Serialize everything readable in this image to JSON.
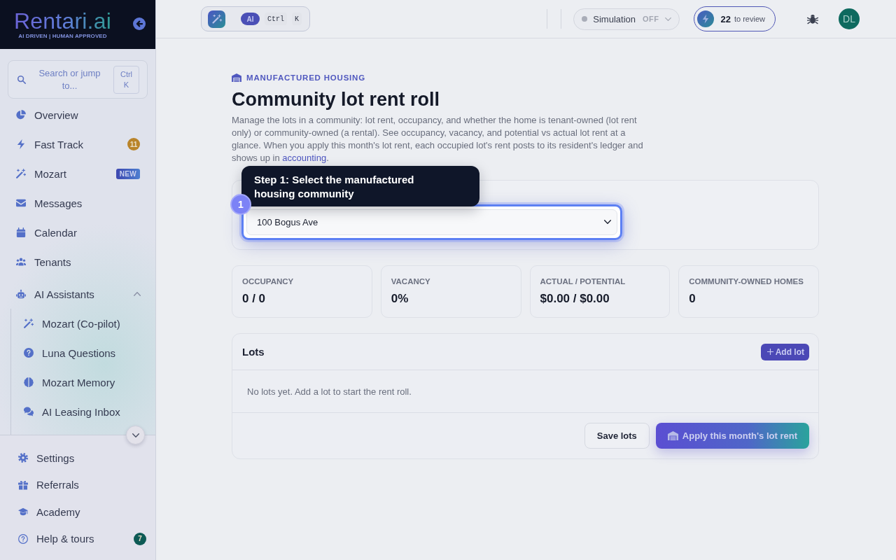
{
  "sidebar": {
    "logo": {
      "wordmark": "Rentari.ai",
      "tagline": "AI DRIVEN | HUMAN APPROVED"
    },
    "search": {
      "placeholder": "Search or jump to...",
      "shortcut": "Ctrl K"
    },
    "nav": [
      {
        "label": "Overview"
      },
      {
        "label": "Fast Track",
        "badge": {
          "kind": "count",
          "text": "11",
          "color": "#b9842a"
        }
      },
      {
        "label": "Mozart",
        "badge": {
          "kind": "new",
          "text": "NEW"
        }
      },
      {
        "label": "Messages"
      },
      {
        "label": "Calendar"
      },
      {
        "label": "Tenants"
      },
      {
        "label": "AI Assistants",
        "expanded": true,
        "children": [
          {
            "label": "Mozart (Co-pilot)"
          },
          {
            "label": "Luna Questions"
          },
          {
            "label": "Mozart Memory"
          },
          {
            "label": "AI Leasing Inbox"
          }
        ]
      }
    ],
    "footer_nav": [
      {
        "label": "Settings"
      },
      {
        "label": "Referrals"
      },
      {
        "label": "Academy"
      },
      {
        "label": "Help & tours",
        "badge": {
          "kind": "count",
          "text": "7",
          "color": "#0d5a55"
        }
      }
    ]
  },
  "topbar": {
    "command": {
      "ai_label": "AI",
      "keys": [
        "Ctrl",
        "K"
      ]
    },
    "simulation": {
      "label": "Simulation",
      "state": "OFF",
      "on": false
    },
    "review": {
      "count": "22",
      "label": "to review"
    },
    "avatar": {
      "initials": "DL"
    }
  },
  "main": {
    "eyebrow": "MANUFACTURED HOUSING",
    "title": "Community lot rent roll",
    "description": {
      "text": "Manage the lots in a community: lot rent, occupancy, and whether the home is tenant-owned (lot rent only) or community-owned (a rental). See occupancy, vacancy, and potential vs actual lot rent at a glance. When you apply this month's lot rent, each occupied lot's rent posts to its resident's ledger and shows up in ",
      "link": "accounting",
      "after": "."
    },
    "tour": {
      "step": "1",
      "text": "Step 1: Select the manufactured housing community"
    },
    "community_select": {
      "value": "100 Bogus Ave"
    },
    "stats": [
      {
        "label": "OCCUPANCY",
        "value": "0 / 0"
      },
      {
        "label": "VACANCY",
        "value": "0%"
      },
      {
        "label": "ACTUAL / POTENTIAL",
        "value": "$0.00 / $0.00"
      },
      {
        "label": "COMMUNITY-OWNED HOMES",
        "value": "0"
      }
    ],
    "lots": {
      "title": "Lots",
      "add_label": "Add lot",
      "empty_text": "No lots yet. Add a lot to start the rent roll.",
      "save_label": "Save lots",
      "apply_label": "Apply this month's lot rent"
    }
  }
}
